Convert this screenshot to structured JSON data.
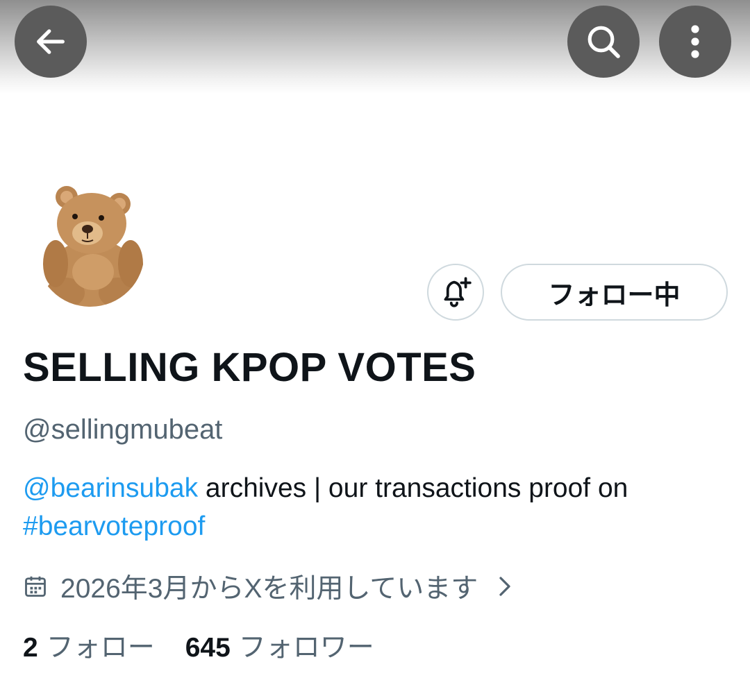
{
  "header": {
    "back_icon": "arrow-left-icon",
    "search_icon": "search-icon",
    "more_icon": "more-vertical-icon"
  },
  "profile": {
    "avatar": "teddy-bear-avatar",
    "display_name": "SELLING KPOP VOTES",
    "handle": "@sellingmubeat",
    "bio": {
      "mention": "@bearinsubak",
      "text": " archives | our transactions proof on ",
      "hashtag": "#bearvoteproof"
    },
    "joined": "2026年3月からXを利用しています",
    "following_count": "2",
    "following_label": "フォロー",
    "followers_count": "645",
    "followers_label": "フォロワー"
  },
  "actions": {
    "notify_icon": "bell-plus-icon",
    "follow_label": "フォロー中"
  },
  "colors": {
    "link": "#1d9bf0",
    "secondary_text": "#536471",
    "primary_text": "#0f1419",
    "border": "#cfd9de",
    "header_button": "#5b5b5b"
  }
}
